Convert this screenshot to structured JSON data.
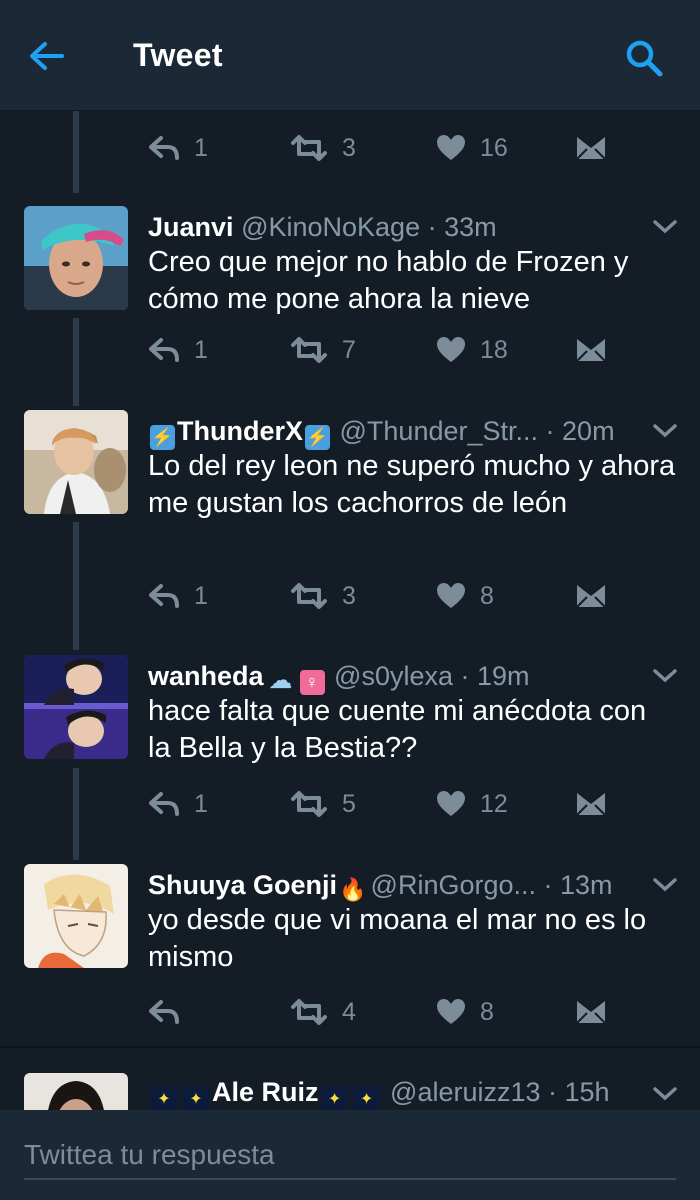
{
  "header": {
    "title": "Tweet",
    "back_icon": "arrow-left-icon",
    "search_icon": "search-icon",
    "accent_color": "#1da1f2"
  },
  "previous_tweet_actions": {
    "replies": "1",
    "retweets": "3",
    "likes": "16"
  },
  "tweets": [
    {
      "name": "Juanvi",
      "name_emoji_before": [],
      "name_emoji_after": [],
      "handle": "@KinoNoKage",
      "time": "· 33m",
      "text": "Creo que mejor no hablo de Frozen y cómo me pone ahora la nieve",
      "replies": "1",
      "retweets": "7",
      "likes": "18"
    },
    {
      "name": "ThunderX",
      "name_emoji_before": [
        "lightning-emoji"
      ],
      "name_emoji_after": [
        "lightning-emoji"
      ],
      "handle": "@Thunder_Str...",
      "time": "· 20m",
      "text": "Lo del rey leon ne superó mucho y ahora me gustan los cachorros de león",
      "replies": "1",
      "retweets": "3",
      "likes": "8"
    },
    {
      "name": "wanheda",
      "name_emoji_before": [],
      "name_emoji_after": [
        "snow-cloud-emoji",
        "female-sign-emoji"
      ],
      "handle": "@s0ylexa",
      "time": "· 19m",
      "text": "hace falta que cuente mi anécdota con la Bella y la Bestia??",
      "replies": "1",
      "retweets": "5",
      "likes": "12"
    },
    {
      "name": "Shuuya Goenji",
      "name_emoji_before": [],
      "name_emoji_after": [
        "fire-emoji"
      ],
      "handle": "@RinGorgo...",
      "time": "· 13m",
      "text": "yo desde que vi moana el mar no es lo mismo",
      "replies": "",
      "retweets": "4",
      "likes": "8"
    },
    {
      "name": "Ale Ruiz",
      "name_emoji_before": [
        "fireworks-emoji",
        "fireworks-emoji"
      ],
      "name_emoji_after": [
        "fireworks-emoji",
        "fireworks-emoji"
      ],
      "handle": "@aleruizz13",
      "time": "· 15h",
      "text": ""
    }
  ],
  "reply_box": {
    "placeholder": "Twittea tu respuesta"
  }
}
